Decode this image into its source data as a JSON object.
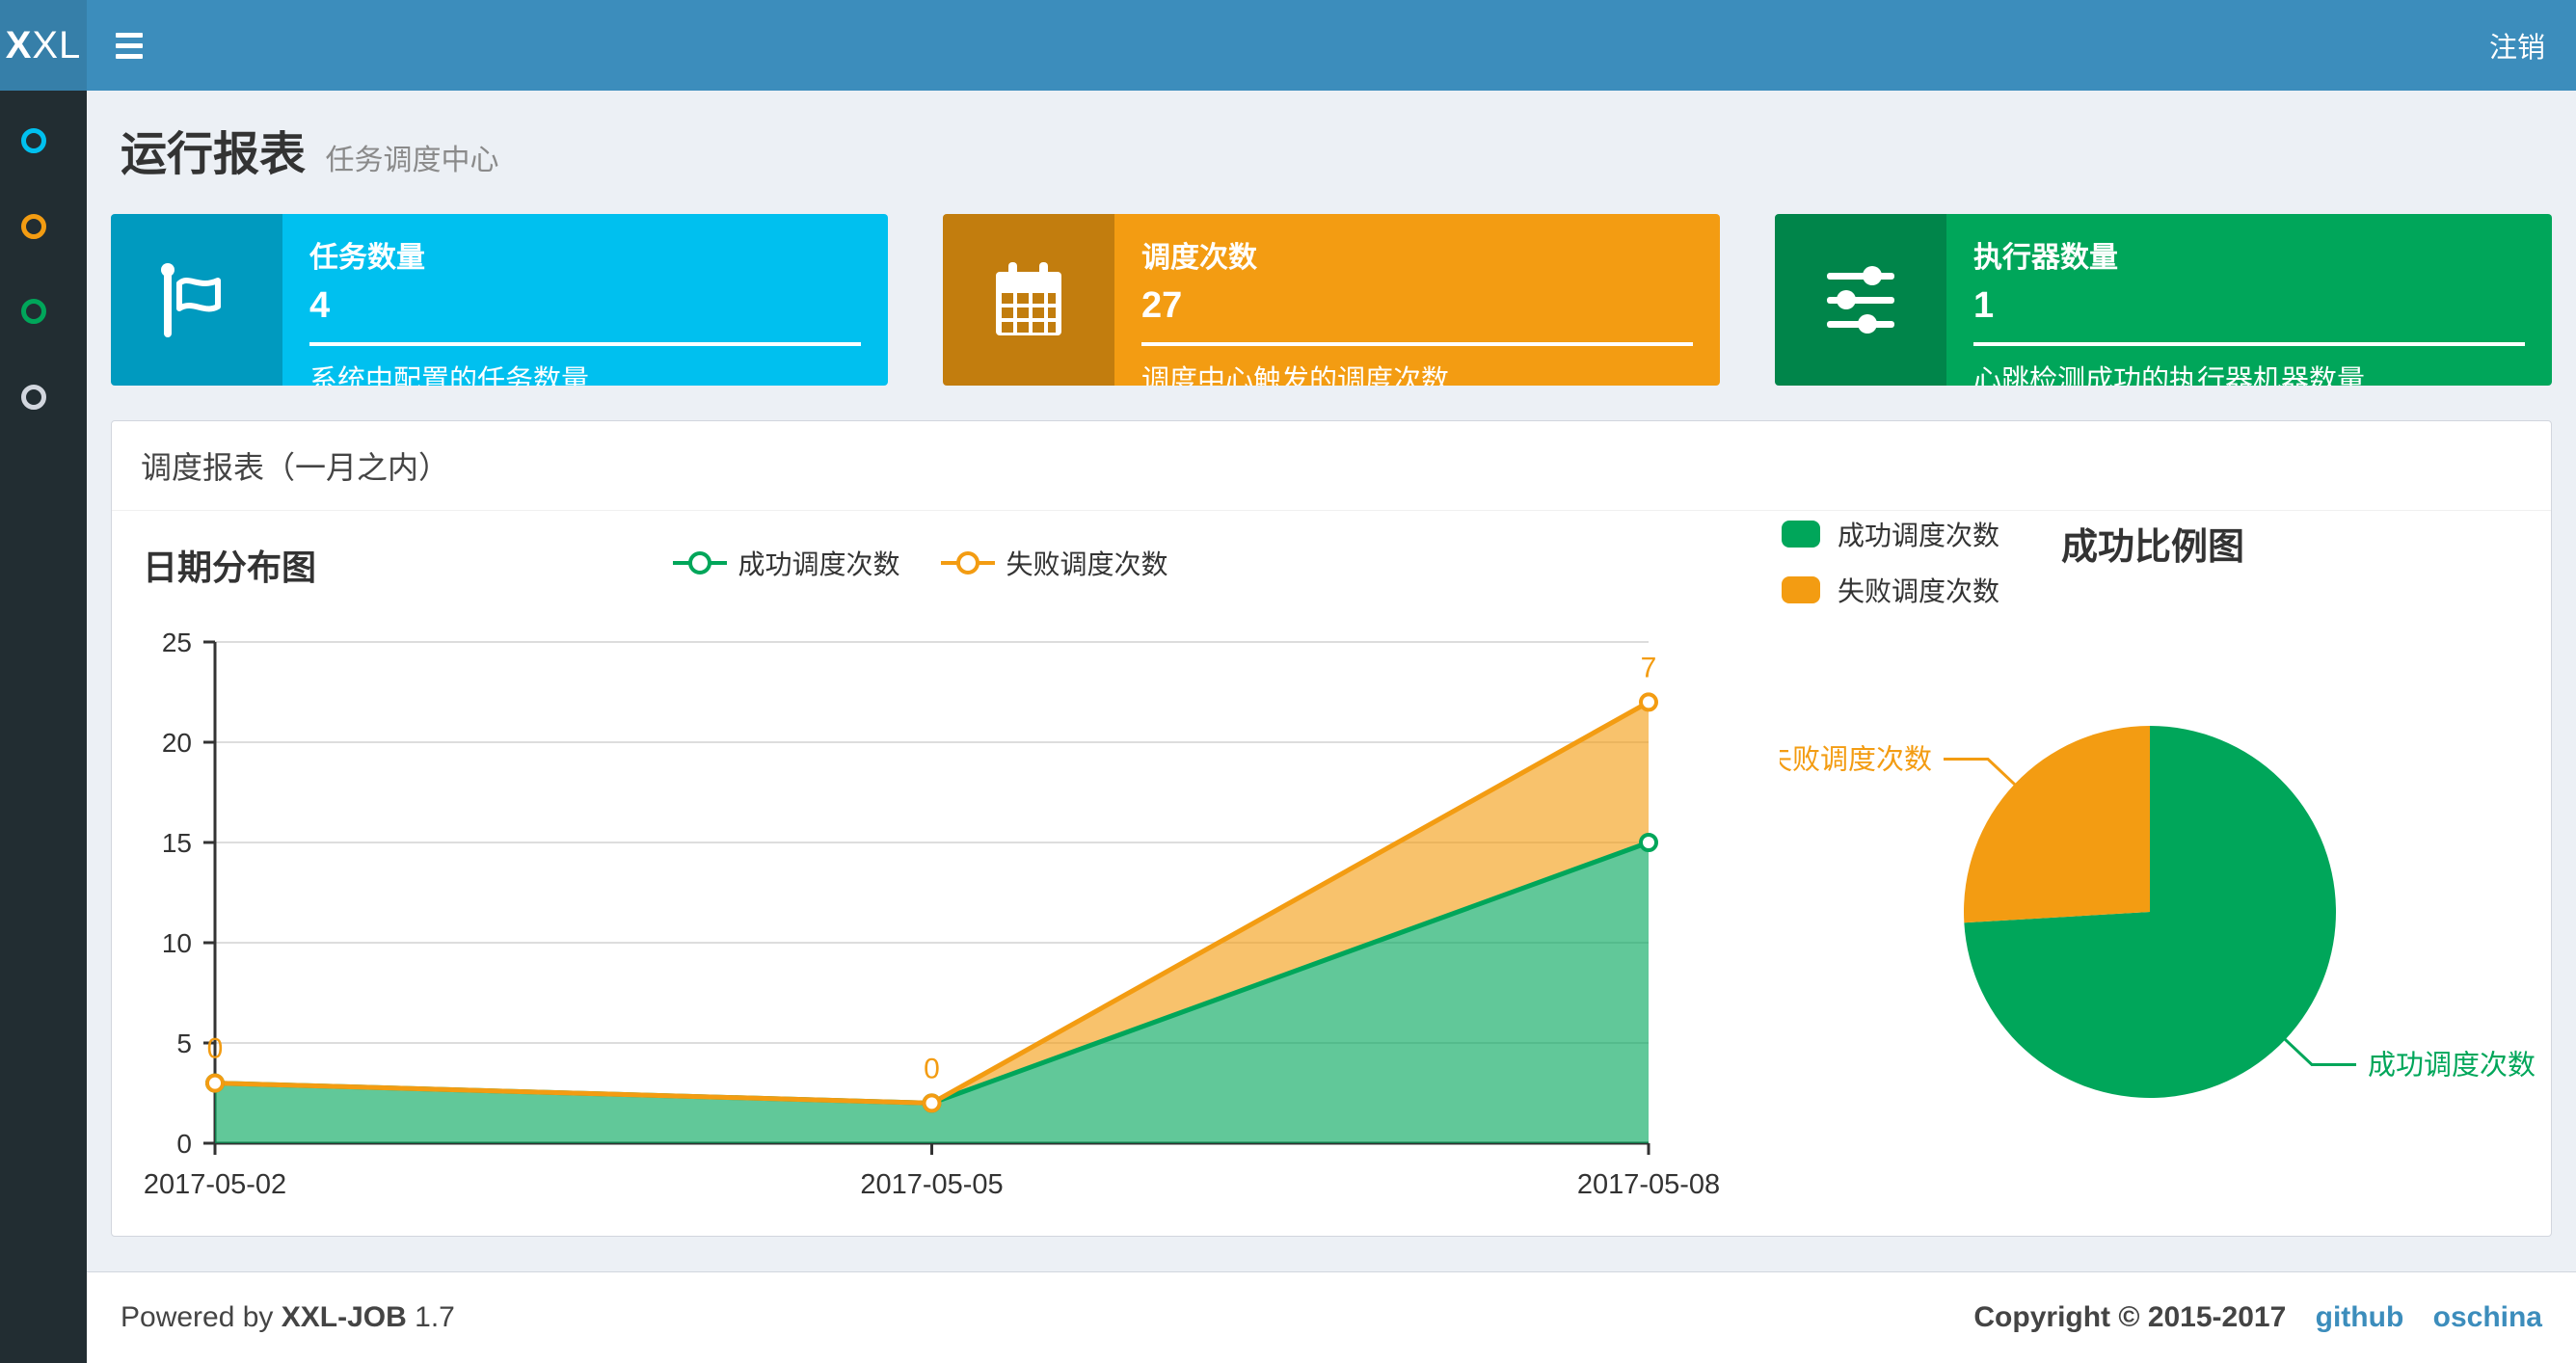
{
  "navbar": {
    "logo_bold": "X",
    "logo_rest": "XL",
    "logout": "注销",
    "color": "#3c8dbc",
    "logo_color": "#367fa9"
  },
  "sidebar": {
    "color": "#222d32",
    "items": [
      {
        "icon": "circle-icon",
        "color": "#00c0ef"
      },
      {
        "icon": "circle-icon",
        "color": "#f39c12"
      },
      {
        "icon": "circle-icon",
        "color": "#00a65a"
      },
      {
        "icon": "circle-icon",
        "color": "#d2d6de"
      }
    ]
  },
  "page_header": {
    "title": "运行报表",
    "subtitle": "任务调度中心"
  },
  "cards": [
    {
      "label": "任务数量",
      "value": "4",
      "desc": "系统中配置的任务数量",
      "icon": "flag-icon",
      "color": "#00c0ef",
      "color_dark": "#009abf"
    },
    {
      "label": "调度次数",
      "value": "27",
      "desc": "调度中心触发的调度次数",
      "icon": "calendar-icon",
      "color": "#f39c12",
      "color_dark": "#c27d0e"
    },
    {
      "label": "执行器数量",
      "value": "1",
      "desc": "心跳检测成功的执行器机器数量",
      "icon": "sliders-icon",
      "color": "#00a65a",
      "color_dark": "#00854a"
    }
  ],
  "panel": {
    "title": "调度报表（一月之内）"
  },
  "chart_data": [
    {
      "type": "area",
      "title": "日期分布图",
      "x": [
        "2017-05-02",
        "2017-05-05",
        "2017-05-08"
      ],
      "series": [
        {
          "name": "成功调度次数",
          "values": [
            3,
            2,
            15
          ],
          "color": "#00a65a"
        },
        {
          "name": "失败调度次数",
          "values": [
            0,
            0,
            7
          ],
          "color": "#f39c12",
          "show_labels": true
        }
      ],
      "stacked": true,
      "xlabel": "",
      "ylabel": "",
      "ylim": [
        0,
        25
      ],
      "yticks": [
        0,
        5,
        10,
        15,
        20,
        25
      ],
      "grid": true,
      "legend_position": "top-center"
    },
    {
      "type": "pie",
      "title": "成功比例图",
      "slices": [
        {
          "name": "成功调度次数",
          "value": 20,
          "color": "#00a65a"
        },
        {
          "name": "失败调度次数",
          "value": 7,
          "color": "#f39c12"
        }
      ],
      "legend_position": "top-left",
      "start_angle_deg": 90,
      "direction": "clockwise"
    }
  ],
  "footer": {
    "powered_prefix": "Powered by",
    "brand": "XXL-JOB",
    "version": "1.7",
    "copyright": "Copyright © 2015-2017",
    "links": [
      "github",
      "oschina"
    ],
    "link_color": "#3c8dbc"
  }
}
